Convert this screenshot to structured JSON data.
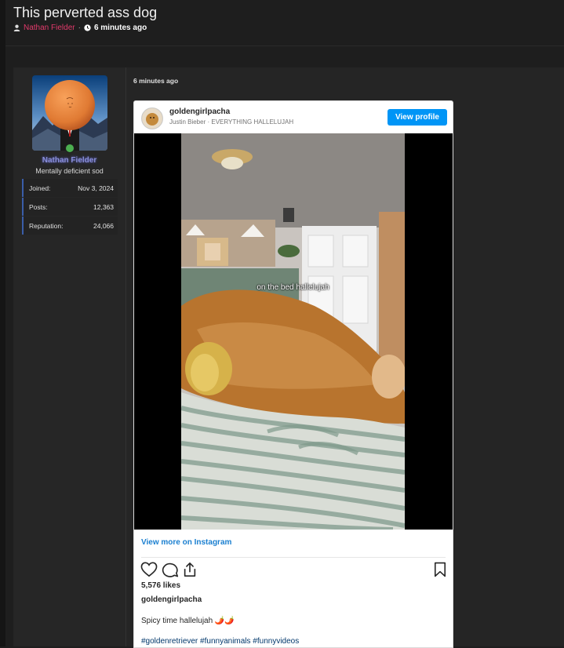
{
  "thread": {
    "title": "This perverted ass dog",
    "author": "Nathan Fielder",
    "separator": "·",
    "time": "6 minutes ago"
  },
  "post": {
    "date": "6 minutes ago",
    "user": {
      "name": "Nathan Fielder",
      "title": "Mentally deficient sod",
      "online_color": "#4caf50",
      "stats": [
        {
          "label": "Joined:",
          "value": "Nov 3, 2024"
        },
        {
          "label": "Posts:",
          "value": "12,363"
        },
        {
          "label": "Reputation:",
          "value": "24,066"
        }
      ]
    }
  },
  "instagram": {
    "username": "goldengirlpacha",
    "audio": "Justin Bieber · EVERYTHING HALLELUJAH",
    "view_profile": "View profile",
    "video_caption": "on the bed hallelujah",
    "view_more": "View more on Instagram",
    "likes": "5,576 likes",
    "caption_user": "goldengirlpacha",
    "caption": "Spicy time hallelujah 🌶️🌶️",
    "hashtags": "#goldenretriever #funnyanimals #funnyvideos",
    "accent_color": "#0095f6"
  }
}
